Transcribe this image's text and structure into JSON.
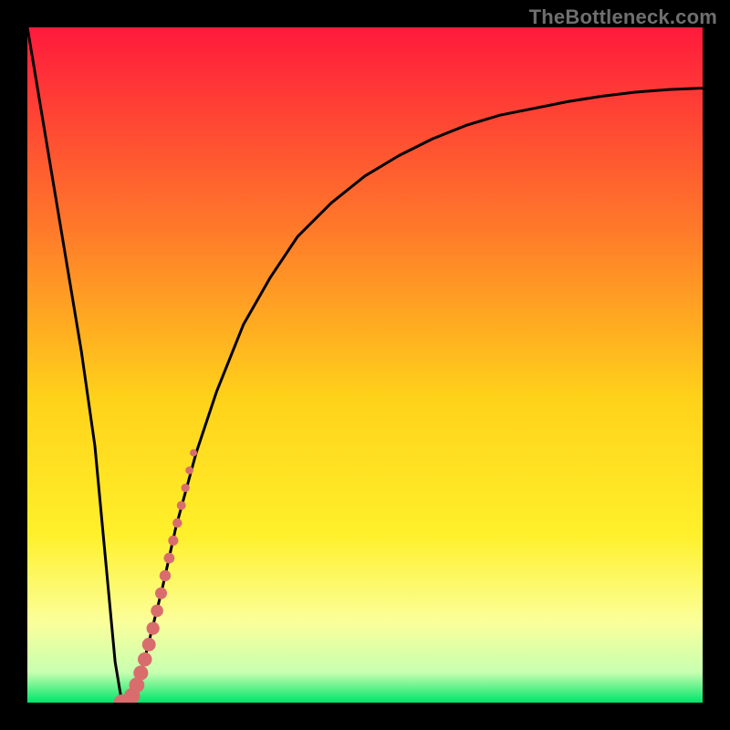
{
  "watermark": "TheBottleneck.com",
  "colors": {
    "gradient_top": "#ff1a3c",
    "gradient_mid_upper": "#ff8a1f",
    "gradient_mid": "#ffe31a",
    "gradient_lower": "#fbff75",
    "gradient_bottom": "#00e56a",
    "curve": "#000000",
    "markers": "#d96d6d",
    "frame": "#000000"
  },
  "chart_data": {
    "type": "line",
    "title": "",
    "xlabel": "",
    "ylabel": "",
    "xlim": [
      0,
      100
    ],
    "ylim": [
      0,
      100
    ],
    "series": [
      {
        "name": "bottleneck-curve",
        "x": [
          0,
          2,
          4,
          6,
          8,
          10,
          11.5,
          13,
          14,
          15,
          16,
          17,
          18,
          20,
          22,
          25,
          28,
          32,
          36,
          40,
          45,
          50,
          55,
          60,
          65,
          70,
          75,
          80,
          85,
          90,
          95,
          100
        ],
        "y": [
          100,
          88,
          76,
          64,
          52,
          38,
          22,
          6,
          0,
          0.5,
          2,
          5,
          9,
          17,
          26,
          37,
          46,
          56,
          63,
          69,
          74,
          78,
          81,
          83.5,
          85.5,
          87,
          88,
          89,
          89.8,
          90.4,
          90.8,
          91
        ]
      },
      {
        "name": "highlight-markers",
        "x": [
          14,
          15.5,
          16.2,
          16.8,
          17.4,
          18,
          18.6,
          19.2,
          19.8,
          20.4,
          21,
          21.6,
          22.2,
          22.8,
          23.4,
          24,
          24.6
        ],
        "y": [
          0,
          1,
          2.6,
          4.4,
          6.4,
          8.6,
          11,
          13.6,
          16.2,
          18.8,
          21.4,
          24,
          26.6,
          29.2,
          31.8,
          34.4,
          37
        ]
      }
    ]
  }
}
